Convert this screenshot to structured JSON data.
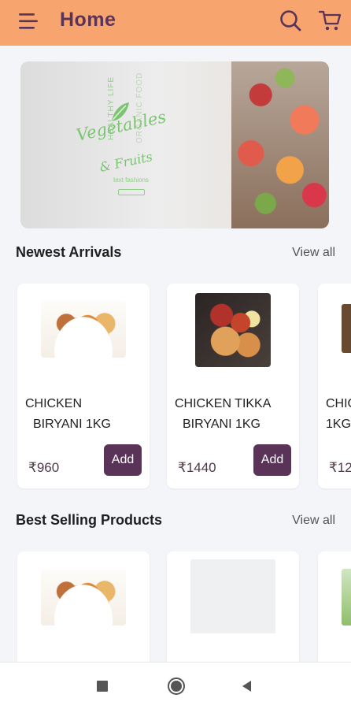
{
  "appbar": {
    "title": "Home",
    "background": "#f8a46e",
    "icons": [
      "menu-icon",
      "search-icon",
      "cart-icon"
    ]
  },
  "banner": {
    "headline_1": "Vegetables",
    "headline_2": "& Fruits",
    "side_text_1": "HEALTHY LIFE",
    "side_text_2": "ORGANIC FOOD",
    "small_text": "text fashions"
  },
  "newest": {
    "title": "Newest Arrivals",
    "view_all": "View all",
    "products": [
      {
        "name_line1": "CHICKEN",
        "name_line2": "BIRYANI 1KG",
        "price": "₹960",
        "add_label": "Add"
      },
      {
        "name_line1": "CHICKEN TIKKA",
        "name_line2": "BIRYANI 1KG",
        "price": "₹1440",
        "add_label": "Add"
      },
      {
        "name_line1": "CHIC",
        "name_line2": "1KG",
        "price": "₹12"
      }
    ]
  },
  "best": {
    "title": "Best Selling Products",
    "view_all": "View all"
  },
  "navbar": {
    "icons": [
      "recents-square-icon",
      "home-circle-icon",
      "back-triangle-icon"
    ]
  },
  "colors": {
    "accent": "#5a3358",
    "appbar": "#f8a46e",
    "background": "#f4f5f9"
  }
}
